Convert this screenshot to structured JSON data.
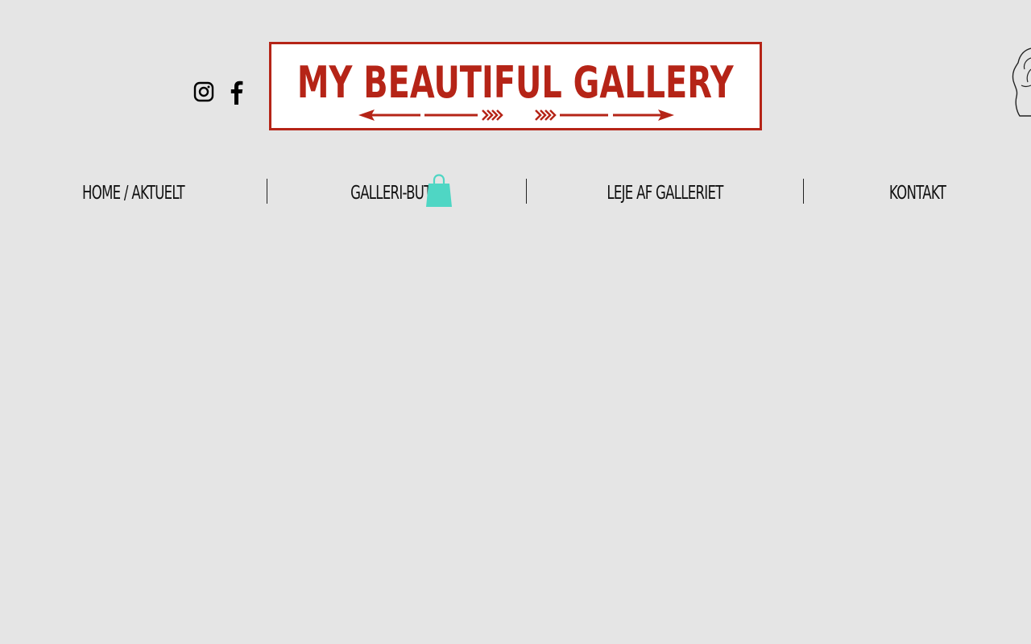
{
  "header": {
    "logo_text": "MY BEAUTIFUL GALLERY",
    "brand_color": "#b52417",
    "social": [
      {
        "name": "instagram-icon"
      },
      {
        "name": "facebook-icon"
      }
    ]
  },
  "nav": {
    "items": [
      {
        "label": "HOME / AKTUELT"
      },
      {
        "label": "GALLERI-BUTIK"
      },
      {
        "label": "LEJE AF GALLERIET"
      },
      {
        "label": "KONTAKT"
      }
    ]
  },
  "cart": {
    "icon": "shopping-bag-icon",
    "color": "#4fd6c4",
    "count": ""
  }
}
